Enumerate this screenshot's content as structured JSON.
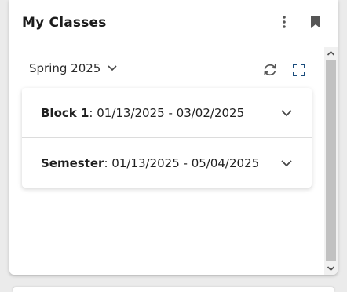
{
  "widget": {
    "title": "My Classes",
    "menu_icon": "more-vertical-icon",
    "bookmark_icon": "bookmark-icon"
  },
  "toolbar": {
    "term_label": "Spring 2025",
    "term_icon": "chevron-down-icon",
    "refresh_icon": "refresh-icon",
    "expand_icon": "fullscreen-icon"
  },
  "classes": [
    {
      "name": "Block 1",
      "separator": ": ",
      "start": "01/13/2025",
      "dash": " - ",
      "end": "03/02/2025"
    },
    {
      "name": "Semester",
      "separator": ": ",
      "start": "01/13/2025",
      "dash": " - ",
      "end": "05/04/2025"
    }
  ],
  "colors": {
    "accent": "#1a4c7c",
    "icon": "#555555",
    "scroll_thumb": "#c1c1c1"
  }
}
